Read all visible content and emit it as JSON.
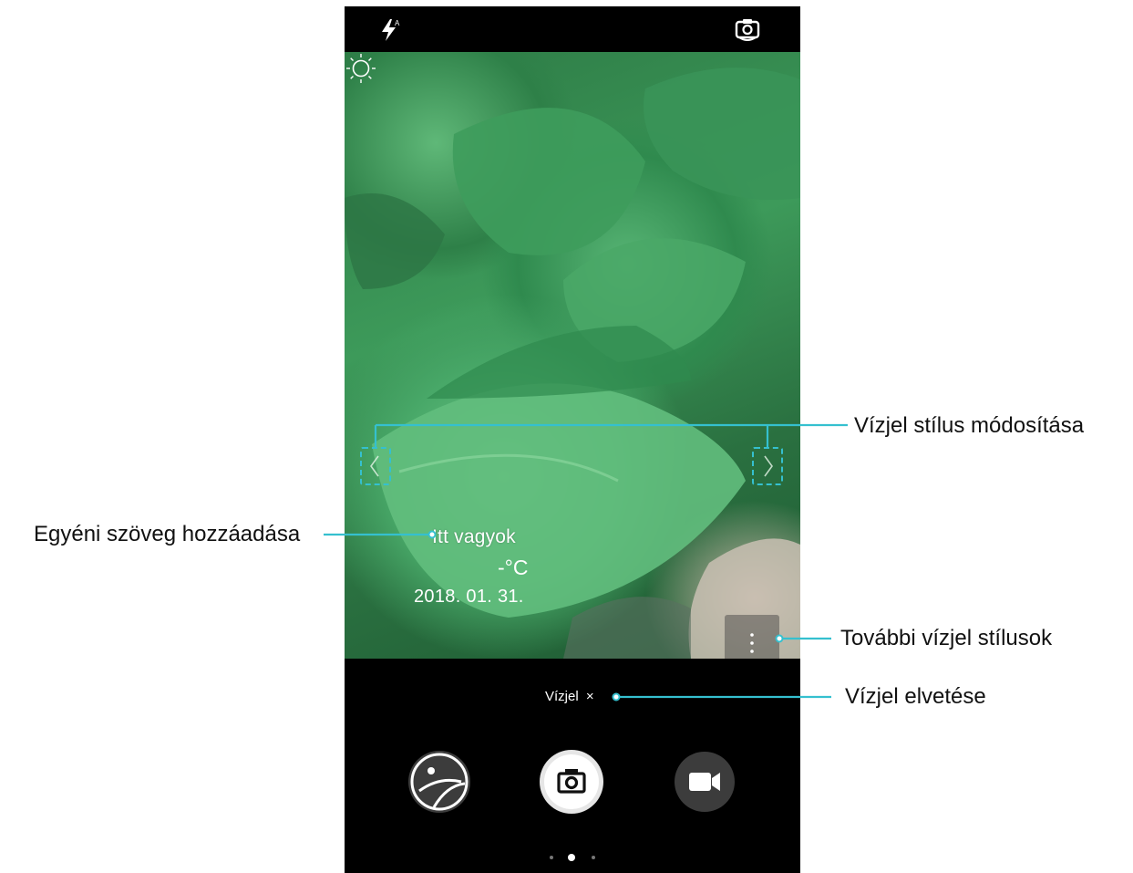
{
  "watermark": {
    "custom_text": "Itt vagyok",
    "temperature": "-°C",
    "date": "2018. 01. 31."
  },
  "bottom_bar": {
    "watermark_chip_label": "Vízjel",
    "dismiss_glyph": "×"
  },
  "callouts": {
    "change_style": "Vízjel stílus módosítása",
    "add_text": "Egyéni szöveg hozzáadása",
    "more_styles": "További vízjel stílusok",
    "dismiss": "Vízjel elvetése"
  },
  "icons": {
    "flash": "flash-auto-icon",
    "switch_camera": "switch-camera-icon",
    "left_arrow": "chevron-left-icon",
    "right_arrow": "chevron-right-icon",
    "weather": "sun-icon",
    "more": "more-vertical-icon",
    "gallery": "gallery-thumbnail-icon",
    "shutter": "camera-shutter-icon",
    "video": "video-camera-icon"
  },
  "page_indicator": {
    "count": 3,
    "active": 1
  },
  "colors": {
    "callout_line": "#35c0cf",
    "phone_bg": "#000000",
    "label_text": "#111111"
  }
}
